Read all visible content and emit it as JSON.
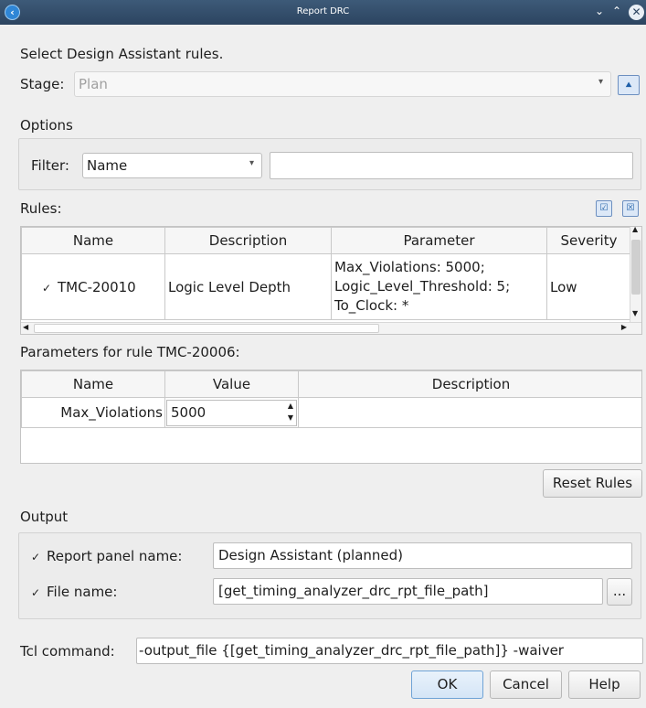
{
  "window": {
    "title": "Report DRC",
    "icon": "quartus-logo-icon"
  },
  "header": {
    "instruction": "Select Design Assistant rules."
  },
  "stage": {
    "label": "Stage:",
    "value": "Plan"
  },
  "options": {
    "heading": "Options",
    "filter_label": "Filter:",
    "filter_value": "Name",
    "filter_text": ""
  },
  "rules": {
    "label": "Rules:",
    "columns": [
      "Name",
      "Description",
      "Parameter",
      "Severity"
    ],
    "row": {
      "checked": true,
      "name": "TMC-20010",
      "description": "Logic Level Depth",
      "param_line1": "Max_Violations: 5000;",
      "param_line2": "Logic_Level_Threshold: 5;",
      "param_line3": "To_Clock: *",
      "severity": "Low"
    }
  },
  "parameters": {
    "label": "Parameters for rule TMC-20006:",
    "columns": [
      "Name",
      "Value",
      "Description"
    ],
    "row": {
      "name": "Max_Violations",
      "value": "5000",
      "description": ""
    }
  },
  "reset_rules_label": "Reset Rules",
  "output": {
    "heading": "Output",
    "panel_label": "Report panel name:",
    "panel_value": "Design Assistant (planned)",
    "panel_checked": true,
    "file_label": "File name:",
    "file_value": "[get_timing_analyzer_drc_rpt_file_path]",
    "file_checked": true,
    "browse_label": "..."
  },
  "tcl": {
    "label": "Tcl command:",
    "value": "-output_file {[get_timing_analyzer_drc_rpt_file_path]} -waiver"
  },
  "buttons": {
    "ok": "OK",
    "cancel": "Cancel",
    "help": "Help"
  }
}
